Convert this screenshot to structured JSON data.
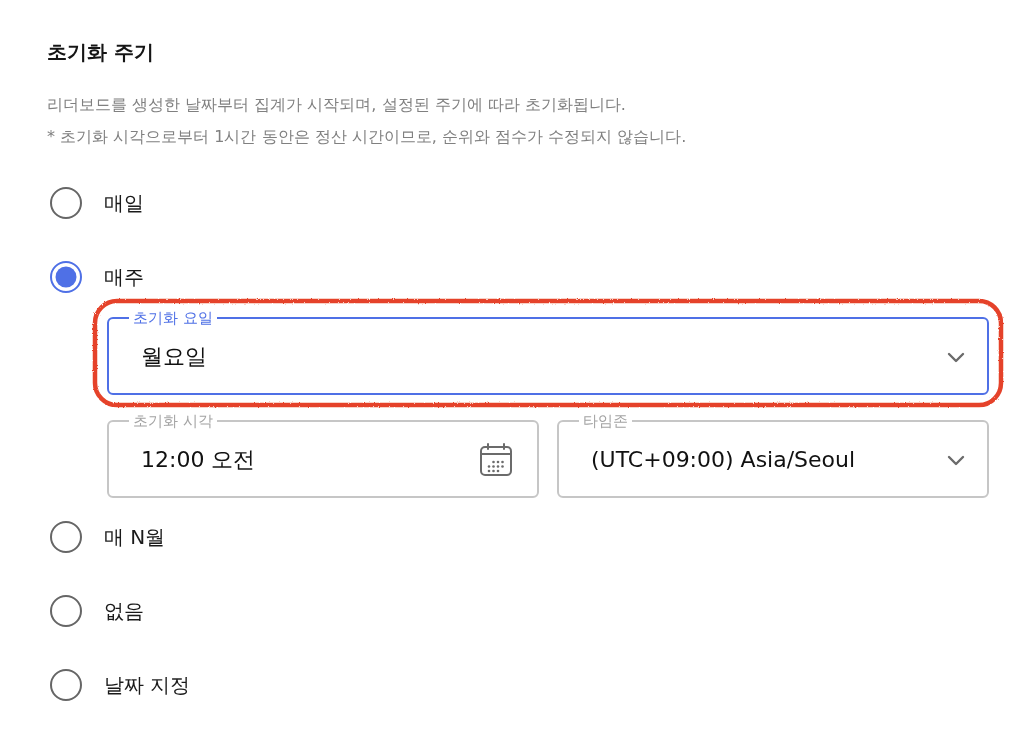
{
  "section": {
    "title": "초기화 주기",
    "description": [
      "리더보드를 생성한 날짜부터 집계가 시작되며, 설정된 주기에 따라 초기화됩니다.",
      "* 초기화 시각으로부터 1시간 동안은 정산 시간이므로, 순위와 점수가 수정되지 않습니다."
    ]
  },
  "options": [
    {
      "label": "매일",
      "selected": false
    },
    {
      "label": "매주",
      "selected": true,
      "field_rows": [
        [
          {
            "kind": "select",
            "label": "초기화 요일",
            "value": "월요일",
            "focused": true,
            "highlighted": true
          }
        ],
        [
          {
            "kind": "time",
            "label": "초기화 시각",
            "value": "12:00 오전",
            "focused": false,
            "highlighted": false
          },
          {
            "kind": "select",
            "label": "타임존",
            "value": "(UTC+09:00) Asia/Seoul",
            "focused": false,
            "highlighted": false
          }
        ]
      ]
    },
    {
      "label": "매 N월",
      "selected": false
    },
    {
      "label": "없음",
      "selected": false
    },
    {
      "label": "날짜 지정",
      "selected": false
    }
  ]
}
